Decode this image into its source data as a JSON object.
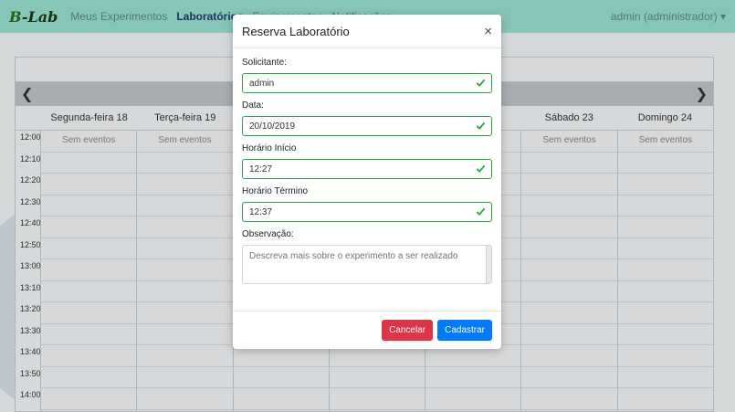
{
  "navbar": {
    "brand_first": "B",
    "brand_rest": "Lab",
    "links": [
      {
        "label": "Meus Experimentos",
        "active": false
      },
      {
        "label": "Laboratórios",
        "active": true
      },
      {
        "label": "Equipamentos",
        "active": false
      },
      {
        "label": "Notificações",
        "active": false
      }
    ],
    "user": "admin (administrador) ▾"
  },
  "calendar": {
    "days": [
      "Segunda-feira 18",
      "Terça-feira 19",
      "",
      "",
      "",
      "Sábado 23",
      "Domingo 24"
    ],
    "empty_label": "Sem eventos",
    "times": [
      "12:00",
      "12:10",
      "12:20",
      "12:30",
      "12:40",
      "12:50",
      "13:00",
      "13:10",
      "13:20",
      "13:30",
      "13:40",
      "13:50",
      "14:00"
    ]
  },
  "modal": {
    "title": "Reserva Laboratório",
    "close": "×",
    "fields": {
      "requester_label": "Solicitante:",
      "requester_value": "admin",
      "date_label": "Data:",
      "date_value": "20/10/2019",
      "start_label": "Horário Início",
      "start_value": "12:27",
      "end_label": "Horário Término",
      "end_value": "12:37",
      "notes_label": "Observação:",
      "notes_placeholder": "Descreva mais sobre o experimento a ser realizado"
    },
    "buttons": {
      "cancel": "Cancelar",
      "submit": "Cadastrar"
    }
  },
  "colors": {
    "valid": "#28a745",
    "danger": "#dc3545",
    "primary": "#007bff",
    "navbar": "#9be1d3"
  },
  "icons": {
    "prev": "chevron-left-icon",
    "next": "chevron-right-icon",
    "valid": "check-icon"
  }
}
